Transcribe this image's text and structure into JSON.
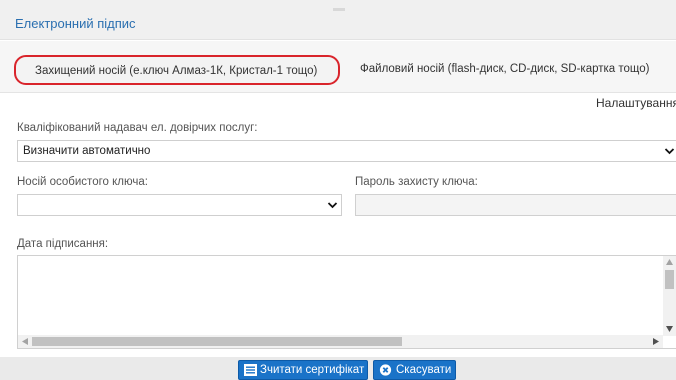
{
  "dialog": {
    "title": "Електронний підпис"
  },
  "tabs": [
    {
      "label": "Захищений носій (е.ключ Алмаз-1К, Кристал-1 тощо)",
      "active": true
    },
    {
      "label": "Файловий носій (flash-диск, CD-диск, SD-картка тощо)",
      "active": false
    }
  ],
  "settings_link": "Налаштування",
  "form": {
    "provider": {
      "label": "Кваліфікований надавач ел. довірчих послуг:",
      "value": "Визначити автоматично"
    },
    "key_media": {
      "label": "Носій особистого ключа:",
      "value": ""
    },
    "key_password": {
      "label": "Пароль захисту ключа:",
      "value": ""
    },
    "sign_date": {
      "label": "Дата підписання:",
      "value": ""
    }
  },
  "buttons": {
    "read_certificate": "Зчитати сертифікат",
    "cancel": "Скасувати"
  },
  "colors": {
    "accent": "#1a73c8",
    "highlight": "#d9242b",
    "title": "#2a6fb0"
  },
  "icons": {
    "dropdown": "chevron-down-icon",
    "read_certificate": "certificate-icon",
    "cancel": "close-circle-icon"
  }
}
